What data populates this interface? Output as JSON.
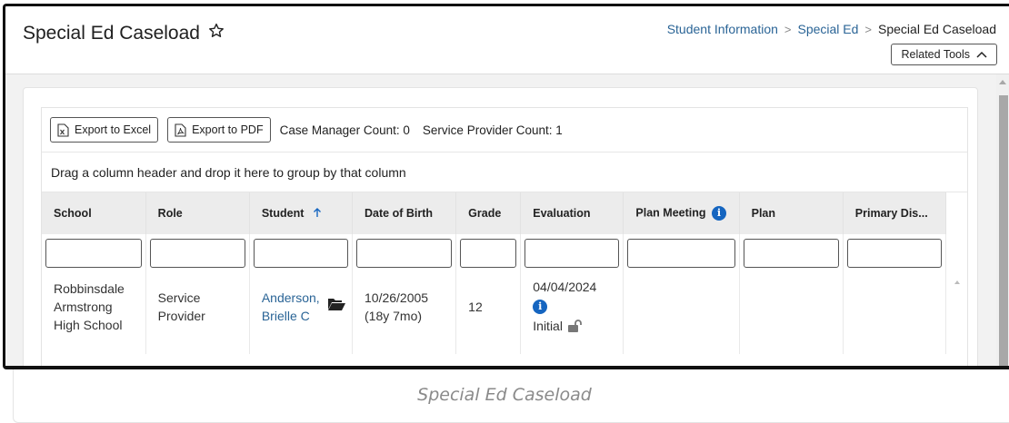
{
  "header": {
    "title": "Special Ed Caseload",
    "breadcrumb": [
      "Student Information",
      "Special Ed",
      "Special Ed Caseload"
    ],
    "related_tools_label": "Related Tools"
  },
  "toolbar": {
    "export_excel_label": "Export to Excel",
    "export_pdf_label": "Export to PDF",
    "case_manager_count": "Case Manager Count: 0",
    "service_provider_count": "Service Provider Count: 1"
  },
  "group_hint": "Drag a column header and drop it here to group by that column",
  "table": {
    "columns": [
      "School",
      "Role",
      "Student",
      "Date of Birth",
      "Grade",
      "Evaluation",
      "Plan Meeting",
      "Plan",
      "Primary Dis..."
    ],
    "sorted_column": "Student",
    "sort_direction": "ascending",
    "rows": [
      {
        "school": "Robbinsdale Armstrong High School",
        "role": "Service Provider",
        "student_name": "Anderson, Brielle C",
        "dob": "10/26/2005",
        "age": "(18y 7mo)",
        "grade": "12",
        "evaluation_date": "04/04/2024",
        "evaluation_type": "Initial",
        "plan_meeting": "",
        "plan": "",
        "primary_disability": ""
      }
    ]
  },
  "caption": "Special Ed Caseload",
  "colors": {
    "link": "#2a6496",
    "info": "#1565c0",
    "header_bg": "#ececec"
  }
}
